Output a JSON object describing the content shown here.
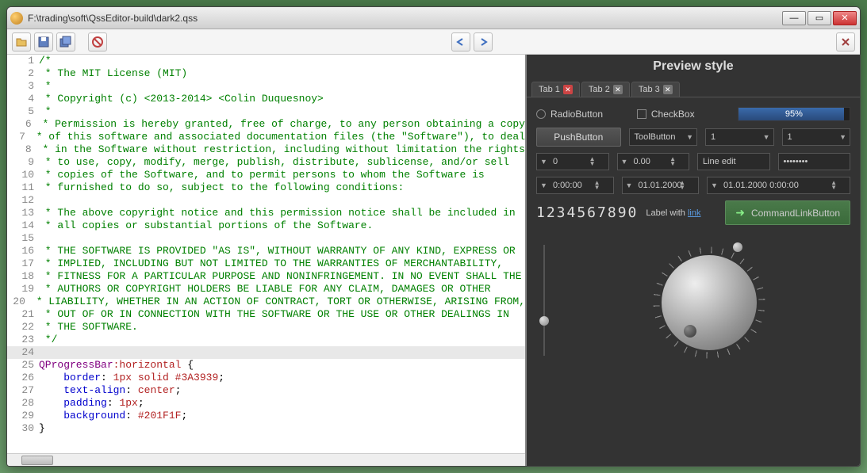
{
  "window": {
    "title": "F:\\trading\\soft\\QssEditor-build\\dark2.qss"
  },
  "toolbar": {
    "open_icon": "open",
    "save_icon": "save",
    "saveall_icon": "saveall",
    "stop_icon": "stop",
    "undo_icon": "undo",
    "redo_icon": "redo",
    "close_icon": "close"
  },
  "code": {
    "lines": [
      {
        "n": 1,
        "cls": "tok-comment",
        "t": "/*"
      },
      {
        "n": 2,
        "cls": "tok-comment",
        "t": " * The MIT License (MIT)"
      },
      {
        "n": 3,
        "cls": "tok-comment",
        "t": " *"
      },
      {
        "n": 4,
        "cls": "tok-comment",
        "t": " * Copyright (c) <2013-2014> <Colin Duquesnoy>"
      },
      {
        "n": 5,
        "cls": "tok-comment",
        "t": " *"
      },
      {
        "n": 6,
        "cls": "tok-comment",
        "t": " * Permission is hereby granted, free of charge, to any person obtaining a copy"
      },
      {
        "n": 7,
        "cls": "tok-comment",
        "t": " * of this software and associated documentation files (the \"Software\"), to deal"
      },
      {
        "n": 8,
        "cls": "tok-comment",
        "t": " * in the Software without restriction, including without limitation the rights"
      },
      {
        "n": 9,
        "cls": "tok-comment",
        "t": " * to use, copy, modify, merge, publish, distribute, sublicense, and/or sell"
      },
      {
        "n": 10,
        "cls": "tok-comment",
        "t": " * copies of the Software, and to permit persons to whom the Software is"
      },
      {
        "n": 11,
        "cls": "tok-comment",
        "t": " * furnished to do so, subject to the following conditions:"
      },
      {
        "n": 12,
        "cls": "tok-comment",
        "t": ""
      },
      {
        "n": 13,
        "cls": "tok-comment",
        "t": " * The above copyright notice and this permission notice shall be included in"
      },
      {
        "n": 14,
        "cls": "tok-comment",
        "t": " * all copies or substantial portions of the Software."
      },
      {
        "n": 15,
        "cls": "tok-comment",
        "t": ""
      },
      {
        "n": 16,
        "cls": "tok-comment",
        "t": " * THE SOFTWARE IS PROVIDED \"AS IS\", WITHOUT WARRANTY OF ANY KIND, EXPRESS OR"
      },
      {
        "n": 17,
        "cls": "tok-comment",
        "t": " * IMPLIED, INCLUDING BUT NOT LIMITED TO THE WARRANTIES OF MERCHANTABILITY,"
      },
      {
        "n": 18,
        "cls": "tok-comment",
        "t": " * FITNESS FOR A PARTICULAR PURPOSE AND NONINFRINGEMENT. IN NO EVENT SHALL THE"
      },
      {
        "n": 19,
        "cls": "tok-comment",
        "t": " * AUTHORS OR COPYRIGHT HOLDERS BE LIABLE FOR ANY CLAIM, DAMAGES OR OTHER"
      },
      {
        "n": 20,
        "cls": "tok-comment",
        "t": " * LIABILITY, WHETHER IN AN ACTION OF CONTRACT, TORT OR OTHERWISE, ARISING FROM,"
      },
      {
        "n": 21,
        "cls": "tok-comment",
        "t": " * OUT OF OR IN CONNECTION WITH THE SOFTWARE OR THE USE OR OTHER DEALINGS IN"
      },
      {
        "n": 22,
        "cls": "tok-comment",
        "t": " * THE SOFTWARE."
      },
      {
        "n": 23,
        "cls": "tok-comment",
        "t": " */"
      },
      {
        "n": 24,
        "cls": "",
        "t": "",
        "hl": true
      },
      {
        "n": 25,
        "raw": "<span class='tok-sel'>QProgressBar</span><span class='tok-pseudo'>:horizontal</span> {"
      },
      {
        "n": 26,
        "raw": "    <span class='tok-prop'>border</span>: <span class='tok-val'>1px solid #3A3939</span>;"
      },
      {
        "n": 27,
        "raw": "    <span class='tok-prop'>text-align</span>: <span class='tok-val'>center</span>;"
      },
      {
        "n": 28,
        "raw": "    <span class='tok-prop'>padding</span>: <span class='tok-val'>1px</span>;"
      },
      {
        "n": 29,
        "raw": "    <span class='tok-prop'>background</span>: <span class='tok-val'>#201F1F</span>;"
      },
      {
        "n": 30,
        "cls": "",
        "t": "}"
      }
    ]
  },
  "preview": {
    "title": "Preview style",
    "tabs": [
      "Tab 1",
      "Tab 2",
      "Tab 3"
    ],
    "radio": "RadioButton",
    "check": "CheckBox",
    "progress": "95%",
    "pushbutton": "PushButton",
    "toolbutton": "ToolButton",
    "combo1": "1",
    "combo2": "1",
    "spin_int": "0",
    "spin_dbl": "0.00",
    "lineedit": "Line edit",
    "password": "••••••••",
    "time": "0:00:00",
    "date": "01.01.2000",
    "datetime": "01.01.2000 0:00:00",
    "lcd": "1234567890",
    "label": "Label with ",
    "link": "link",
    "cmdlink": "CommandLinkButton"
  }
}
